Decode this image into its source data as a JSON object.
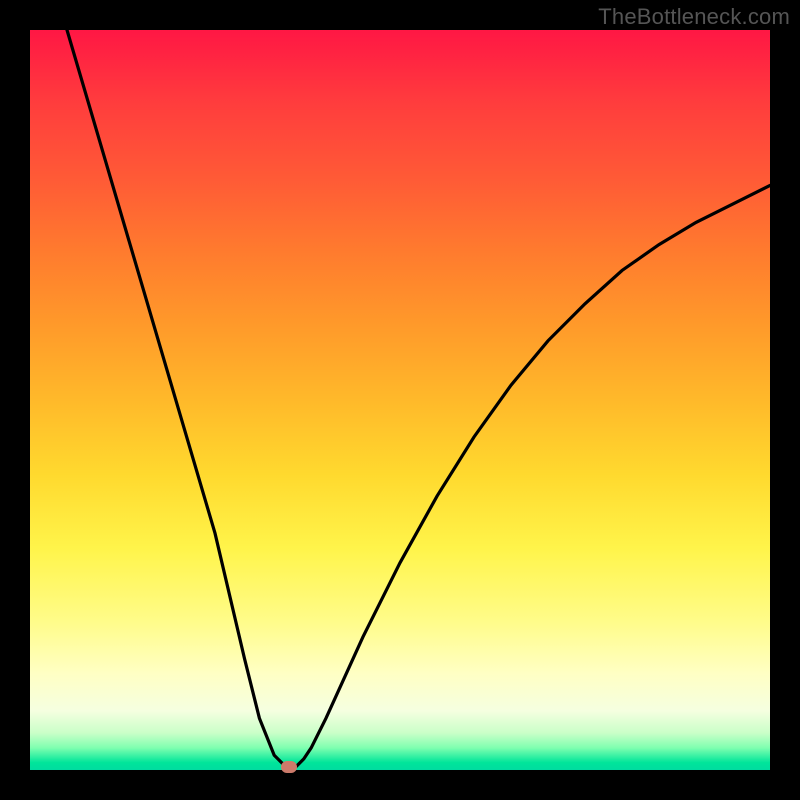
{
  "watermark": "TheBottleneck.com",
  "chart_data": {
    "type": "line",
    "title": "",
    "xlabel": "",
    "ylabel": "",
    "xlim": [
      0,
      100
    ],
    "ylim": [
      0,
      100
    ],
    "grid": false,
    "legend": false,
    "series": [
      {
        "name": "curve",
        "x": [
          5,
          10,
          15,
          20,
          25,
          29,
          31,
          33,
          34,
          35,
          36,
          37,
          38,
          40,
          45,
          50,
          55,
          60,
          65,
          70,
          75,
          80,
          85,
          90,
          95,
          100
        ],
        "y": [
          100,
          83,
          66,
          49,
          32,
          15,
          7,
          2,
          1,
          0,
          0.5,
          1.5,
          3,
          7,
          18,
          28,
          37,
          45,
          52,
          58,
          63,
          67.5,
          71,
          74,
          76.5,
          79
        ]
      }
    ],
    "marker": {
      "x": 35,
      "y": 0
    },
    "colors": {
      "curve": "#000000",
      "marker": "#cc7a6a",
      "gradient_top": "#ff1744",
      "gradient_bottom": "#00dca0"
    }
  }
}
